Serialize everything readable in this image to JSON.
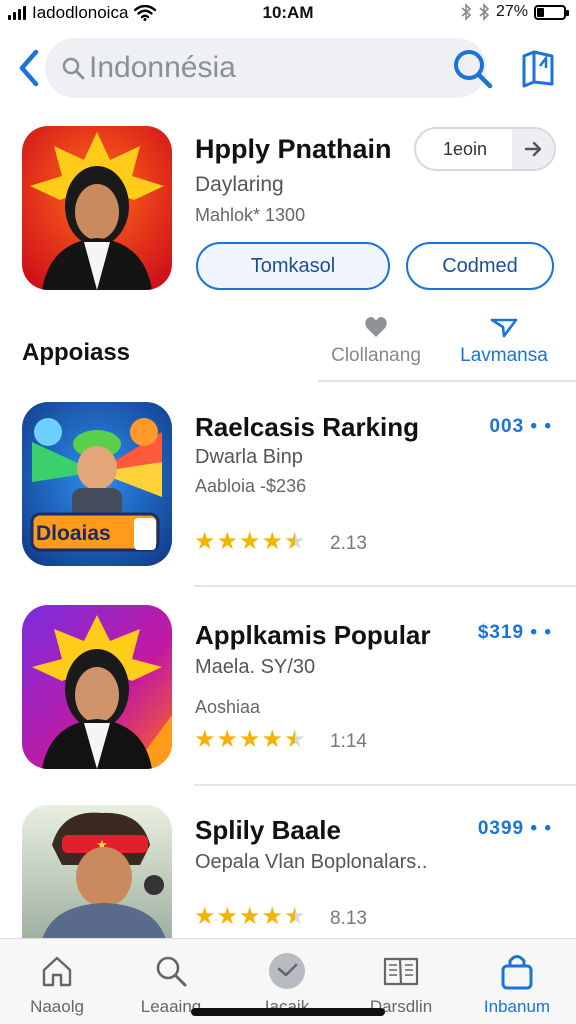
{
  "status_bar": {
    "carrier": "Iadodlonoica",
    "time": "10:AM",
    "battery_percent": "27%",
    "battery_level": 0.27
  },
  "search": {
    "value": "Indonnésia",
    "placeholder": "Indonnésia"
  },
  "featured": {
    "title": "Hpply Pnathain",
    "subtitle": "Daylaring",
    "meta": "Mahlok* 1300",
    "pill_label": "1eoin",
    "button_primary": "Tomkasol",
    "button_secondary": "Codmed"
  },
  "section": {
    "title": "Appoiass",
    "seg_1": "Clollanang",
    "seg_2": "Lavmansa"
  },
  "apps": [
    {
      "title": "Raelcasis Rarking",
      "subtitle": "Dwarla Binp",
      "meta": "Aabloia -$236",
      "price": "003 • •",
      "rating": "2.13",
      "stars": 4.5,
      "icon_badge": "Dloaias"
    },
    {
      "title": "Applkamis Popular",
      "subtitle": "Maela. SY/30",
      "meta": "Aoshiaa",
      "price": "$319 • •",
      "rating": "1:14",
      "stars": 4.5
    },
    {
      "title": "Splily Baale",
      "subtitle": "Oepala Vlan Boplonalars..",
      "meta": "",
      "price": "0399 • •",
      "rating": "8.13",
      "stars": 4.5
    }
  ],
  "tabs": [
    {
      "label": "Naaolg",
      "icon": "home-icon"
    },
    {
      "label": "Leaaing",
      "icon": "search-icon"
    },
    {
      "label": "Iacaik",
      "icon": "check-circle-icon"
    },
    {
      "label": "Darsdlin",
      "icon": "book-icon"
    },
    {
      "label": "Inbanum",
      "icon": "bag-icon"
    }
  ],
  "colors": {
    "accent": "#1a73d8",
    "star": "#f4b400",
    "star_empty": "#d7d9dc"
  }
}
